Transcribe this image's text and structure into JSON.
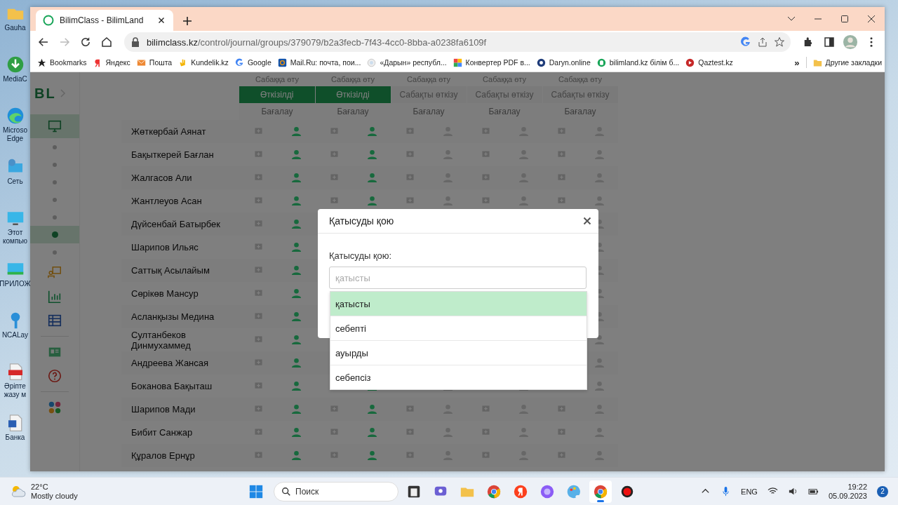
{
  "desktop_icons": [
    {
      "kind": "folder",
      "lines": [
        "Gauha"
      ]
    },
    {
      "kind": "media",
      "lines": [
        "MediaC"
      ]
    },
    {
      "kind": "edge",
      "lines": [
        "Microso",
        "Edge"
      ]
    },
    {
      "kind": "network",
      "lines": [
        "Сеть"
      ]
    },
    {
      "kind": "pc",
      "lines": [
        "Этот",
        "компью"
      ]
    },
    {
      "kind": "apps",
      "lines": [
        "ПРИЛОЖ"
      ]
    },
    {
      "kind": "ncalayer",
      "lines": [
        "NCALay"
      ]
    },
    {
      "kind": "pdf",
      "lines": [
        "Әріпте",
        "жазу м"
      ]
    },
    {
      "kind": "word",
      "lines": [
        "Банка"
      ]
    }
  ],
  "browser": {
    "tab": {
      "title": "BilimClass - BilimLand",
      "selected": true
    },
    "address": {
      "host": "bilimclass.kz",
      "path": "/control/journal/groups/379079/b2a3fecb-7f43-4cc0-8bba-a0238fa6109f"
    },
    "bookmarks": [
      {
        "kind": "star",
        "label": "Bookmarks"
      },
      {
        "kind": "yandex",
        "label": "Яндекс"
      },
      {
        "kind": "mail",
        "label": "Пошта"
      },
      {
        "kind": "kundelik",
        "label": "Kundelik.kz"
      },
      {
        "kind": "google",
        "label": "Google"
      },
      {
        "kind": "mailru",
        "label": "Mail.Ru: почта, пои..."
      },
      {
        "kind": "daryn",
        "label": "«Дарын» республ..."
      },
      {
        "kind": "pdf",
        "label": "Конвертер PDF в..."
      },
      {
        "kind": "darynonline",
        "label": "Daryn.online"
      },
      {
        "kind": "bilimland",
        "label": "bilimland.kz білім б..."
      },
      {
        "kind": "qaztest",
        "label": "Qaztest.kz"
      }
    ],
    "more_bookmarks": "»",
    "other_bookmarks": "Другие закладки"
  },
  "sidebar": {
    "logo": "BL",
    "items": [
      {
        "kind": "monitor",
        "selected": true
      },
      {
        "kind": "dot",
        "selected": false
      },
      {
        "kind": "dot",
        "selected": false
      },
      {
        "kind": "dot",
        "selected": false
      },
      {
        "kind": "dot",
        "selected": false
      },
      {
        "kind": "dot",
        "selected": false
      },
      {
        "kind": "dot",
        "selected": true
      },
      {
        "kind": "dot",
        "selected": false
      },
      {
        "kind": "presentation",
        "selected": false
      },
      {
        "kind": "chart",
        "selected": false
      },
      {
        "kind": "table",
        "selected": false
      },
      {
        "kind": "divider"
      },
      {
        "kind": "card",
        "selected": false
      },
      {
        "kind": "help",
        "selected": false
      },
      {
        "kind": "divider"
      },
      {
        "kind": "apps",
        "selected": false
      }
    ]
  },
  "journal": {
    "lessons": [
      {
        "top": "Сабаққа өту",
        "status": "Өткізілді",
        "conducted": true,
        "grade": "Бағалау"
      },
      {
        "top": "Сабаққа өту",
        "status": "Өткізілді",
        "conducted": true,
        "grade": "Бағалау"
      },
      {
        "top": "Сабаққа өту",
        "status": "Сабақты өткізу",
        "conducted": false,
        "grade": "Бағалау"
      },
      {
        "top": "Сабаққа өту",
        "status": "Сабақты өткізу",
        "conducted": false,
        "grade": "Бағалау"
      },
      {
        "top": "Сабаққа өту",
        "status": "Сабақты өткізу",
        "conducted": false,
        "grade": "Бағалау"
      }
    ],
    "students": [
      {
        "name": "Жөткөрбай Аянат",
        "cells": [
          {
            "kind": "mark",
            "present": true
          },
          {
            "kind": "mark",
            "present": true
          },
          {
            "kind": "mark",
            "present": false
          },
          {
            "kind": "mark",
            "present": false
          },
          {
            "kind": "mark",
            "present": false
          }
        ]
      },
      {
        "name": "Бақыткерей Бағлан",
        "cells": [
          {
            "kind": "mark",
            "present": true
          },
          {
            "kind": "mark",
            "present": true
          },
          {
            "kind": "mark",
            "present": false
          },
          {
            "kind": "mark",
            "present": false
          },
          {
            "kind": "mark",
            "present": false
          }
        ]
      },
      {
        "name": "Жалгасов Али",
        "cells": [
          {
            "kind": "mark",
            "present": true
          },
          {
            "kind": "mark",
            "present": true
          },
          {
            "kind": "mark",
            "present": false
          },
          {
            "kind": "mark",
            "present": false
          },
          {
            "kind": "mark",
            "present": false
          }
        ]
      },
      {
        "name": "Жантлеуов Асан",
        "cells": [
          {
            "kind": "mark",
            "present": true
          },
          {
            "kind": "mark",
            "present": true
          },
          {
            "kind": "mark",
            "present": false
          },
          {
            "kind": "mark",
            "present": false
          },
          {
            "kind": "mark",
            "present": false
          }
        ]
      },
      {
        "name": "Дүйсенбай Батырбек",
        "cells": [
          {
            "kind": "mark",
            "present": true
          },
          {
            "kind": "covered"
          },
          {
            "kind": "covered"
          },
          {
            "kind": "covered"
          },
          {
            "kind": "mark",
            "present": false
          }
        ]
      },
      {
        "name": "Шарипов Ильяс",
        "cells": [
          {
            "kind": "mark",
            "present": true
          },
          {
            "kind": "covered"
          },
          {
            "kind": "covered"
          },
          {
            "kind": "covered"
          },
          {
            "kind": "mark",
            "present": false
          }
        ]
      },
      {
        "name": "Саттық Асылайым",
        "cells": [
          {
            "kind": "mark",
            "present": true
          },
          {
            "kind": "covered"
          },
          {
            "kind": "covered"
          },
          {
            "kind": "covered"
          },
          {
            "kind": "mark",
            "present": false
          }
        ]
      },
      {
        "name": "Сөрікөв Мансур",
        "cells": [
          {
            "kind": "mark",
            "present": true
          },
          {
            "kind": "covered"
          },
          {
            "kind": "covered"
          },
          {
            "kind": "covered"
          },
          {
            "kind": "mark",
            "present": false
          }
        ]
      },
      {
        "name": "Асланқызы Медина",
        "cells": [
          {
            "kind": "mark",
            "present": true
          },
          {
            "kind": "covered"
          },
          {
            "kind": "covered"
          },
          {
            "kind": "covered"
          },
          {
            "kind": "mark",
            "present": false
          }
        ]
      },
      {
        "name": "Султанбеков Динмухаммед",
        "cells": [
          {
            "kind": "mark",
            "present": true
          },
          {
            "kind": "covered"
          },
          {
            "kind": "covered"
          },
          {
            "kind": "covered"
          },
          {
            "kind": "mark",
            "present": false
          }
        ]
      },
      {
        "name": "Андреева Жансая",
        "cells": [
          {
            "kind": "mark",
            "present": true
          },
          {
            "kind": "covered"
          },
          {
            "kind": "covered"
          },
          {
            "kind": "covered"
          },
          {
            "kind": "mark",
            "present": false
          }
        ]
      },
      {
        "name": "Боканова Бақыташ",
        "cells": [
          {
            "kind": "mark",
            "present": true
          },
          {
            "kind": "mark",
            "present": true
          },
          {
            "kind": "mark",
            "present": false
          },
          {
            "kind": "mark",
            "present": false
          },
          {
            "kind": "mark",
            "present": false
          }
        ]
      },
      {
        "name": "Шарипов Мади",
        "cells": [
          {
            "kind": "mark",
            "present": true
          },
          {
            "kind": "mark",
            "present": true
          },
          {
            "kind": "mark",
            "present": false
          },
          {
            "kind": "mark",
            "present": false
          },
          {
            "kind": "mark",
            "present": false
          }
        ]
      },
      {
        "name": "Бибит Санжар",
        "cells": [
          {
            "kind": "mark",
            "present": true
          },
          {
            "kind": "mark",
            "present": true
          },
          {
            "kind": "mark",
            "present": false
          },
          {
            "kind": "mark",
            "present": false
          },
          {
            "kind": "mark",
            "present": false
          }
        ]
      },
      {
        "name": "Құралов Ернұр",
        "cells": [
          {
            "kind": "mark",
            "present": true
          },
          {
            "kind": "mark",
            "present": true
          },
          {
            "kind": "mark",
            "present": false
          },
          {
            "kind": "mark",
            "present": false
          },
          {
            "kind": "mark",
            "present": false
          }
        ]
      }
    ]
  },
  "modal": {
    "title": "Қатысуды қою",
    "label": "Қатысуды қою:",
    "placeholder": "қатысты",
    "options": [
      {
        "label": "қатысты",
        "selected": true
      },
      {
        "label": "себепті",
        "selected": false
      },
      {
        "label": "ауырды",
        "selected": false
      },
      {
        "label": "себепсіз",
        "selected": false
      }
    ]
  },
  "taskbar": {
    "temperature": "22°C",
    "weather": "Mostly cloudy",
    "search_placeholder": "Поиск",
    "apps": [
      {
        "kind": "explorer",
        "selected": false
      },
      {
        "kind": "teams",
        "selected": false
      },
      {
        "kind": "folder",
        "selected": false
      },
      {
        "kind": "chrome",
        "selected": false
      },
      {
        "kind": "yandex",
        "selected": false
      },
      {
        "kind": "alice",
        "selected": false
      },
      {
        "kind": "paint",
        "selected": false
      },
      {
        "kind": "chrome",
        "selected": true
      },
      {
        "kind": "record",
        "selected": false
      }
    ],
    "language": "ENG",
    "time": "19:22",
    "date": "05.09.2023",
    "notifications": "2"
  }
}
